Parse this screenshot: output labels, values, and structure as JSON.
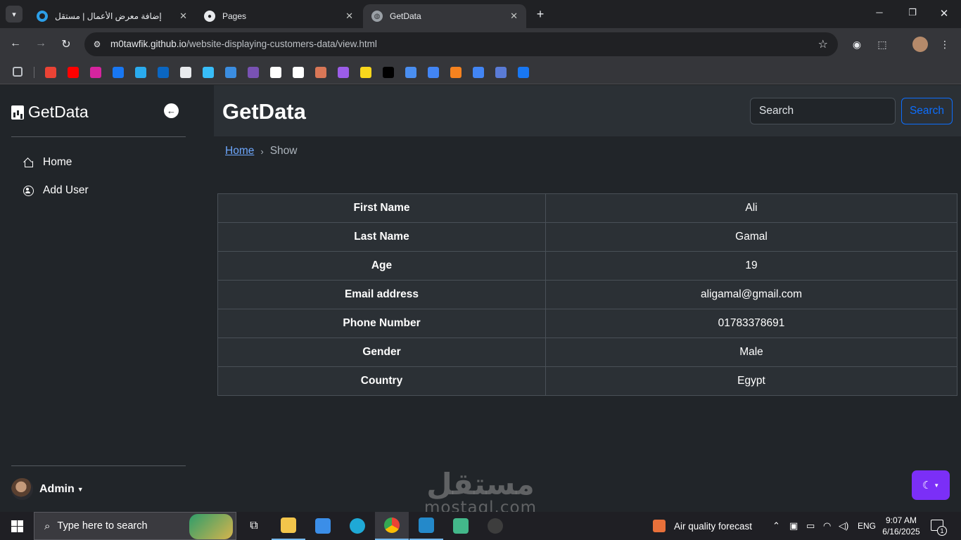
{
  "browser": {
    "tabs": [
      {
        "title": "إضافة معرض الأعمال | مستقل",
        "icon": "mostaql-icon",
        "active": false
      },
      {
        "title": "Pages",
        "icon": "github-icon",
        "active": false
      },
      {
        "title": "GetData",
        "icon": "globe-icon",
        "active": true
      }
    ],
    "url_host": "m0tawfik.github.io",
    "url_path": "/website-displaying-customers-data/view.html",
    "bookmarks": [
      {
        "name": "apps-grid-icon",
        "color": "#3c4043"
      },
      {
        "name": "gmail-icon",
        "color": "#ea4335"
      },
      {
        "name": "youtube-icon",
        "color": "#ff0000"
      },
      {
        "name": "instagram-icon",
        "color": "#d6249f"
      },
      {
        "name": "facebook-icon",
        "color": "#1877f2"
      },
      {
        "name": "telegram-icon",
        "color": "#2aabee"
      },
      {
        "name": "linkedin-icon",
        "color": "#0a66c2"
      },
      {
        "name": "github-icon",
        "color": "#e8eaed"
      },
      {
        "name": "tailwind-icon",
        "color": "#38bdf8"
      },
      {
        "name": "tensorflow-icon",
        "color": "#3b8de0"
      },
      {
        "name": "bootstrap-icon",
        "color": "#7952b3"
      },
      {
        "name": "notion-icon",
        "color": "#ffffff"
      },
      {
        "name": "openai-icon",
        "color": "#ffffff"
      },
      {
        "name": "claude-icon",
        "color": "#d97757"
      },
      {
        "name": "copilot-icon",
        "color": "#9c5de8"
      },
      {
        "name": "bolt-icon",
        "color": "#f9d71c"
      },
      {
        "name": "terminal-icon",
        "color": "#000000"
      },
      {
        "name": "flag-icon",
        "color": "#4a8ef0"
      },
      {
        "name": "forms-icon",
        "color": "#4285f4"
      },
      {
        "name": "fire-icon",
        "color": "#f5821f"
      },
      {
        "name": "translate-icon",
        "color": "#4285f4"
      },
      {
        "name": "person-icon",
        "color": "#5a7bd6"
      },
      {
        "name": "meta-icon",
        "color": "#1877f2"
      }
    ]
  },
  "sidebar": {
    "brand": "GetData",
    "items": [
      {
        "label": "Home",
        "icon": "home-icon"
      },
      {
        "label": "Add User",
        "icon": "user-circle-icon"
      }
    ],
    "user": "Admin"
  },
  "header": {
    "title": "GetData",
    "search_placeholder": "Search",
    "search_button": "Search"
  },
  "breadcrumb": {
    "home": "Home",
    "current": "Show"
  },
  "details": [
    {
      "label": "First Name",
      "value": "Ali"
    },
    {
      "label": "Last Name",
      "value": "Gamal"
    },
    {
      "label": "Age",
      "value": "19"
    },
    {
      "label": "Email address",
      "value": "aligamal@gmail.com"
    },
    {
      "label": "Phone Number",
      "value": "01783378691"
    },
    {
      "label": "Gender",
      "value": "Male"
    },
    {
      "label": "Country",
      "value": "Egypt"
    }
  ],
  "watermark": {
    "arabic": "مستقل",
    "latin": "mostaql.com"
  },
  "taskbar": {
    "search_placeholder": "Type here to search",
    "weather": "Air quality forecast",
    "language": "ENG",
    "time": "9:07 AM",
    "date": "6/16/2025",
    "notifications": "1"
  },
  "colors": {
    "accent": "#0d6efd",
    "theme_button": "#7b2ff7",
    "page_bg": "#212529",
    "header_bg": "#2b3035"
  }
}
